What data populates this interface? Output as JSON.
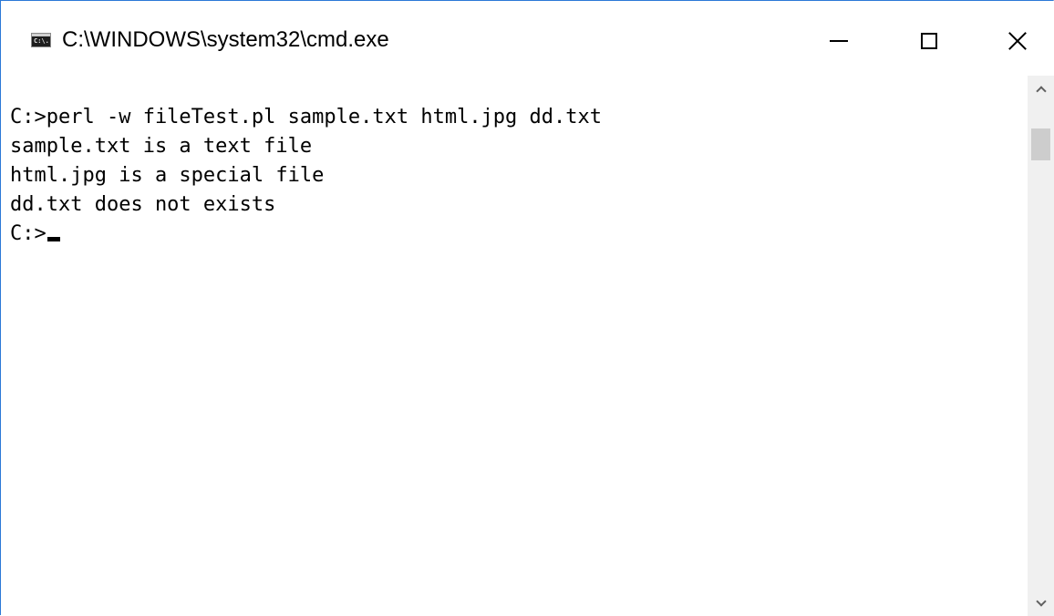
{
  "window": {
    "title": "C:\\WINDOWS\\system32\\cmd.exe",
    "icon": "console-app-icon",
    "icon_text": "C:\\."
  },
  "caption_buttons": {
    "minimize": "minimize-icon",
    "maximize": "maximize-icon",
    "close": "close-icon"
  },
  "console": {
    "lines": [
      "C:>perl -w fileTest.pl sample.txt html.jpg dd.txt",
      "sample.txt is a text file",
      "html.jpg is a special file",
      "dd.txt does not exists"
    ],
    "prompt": "C:>"
  },
  "colors": {
    "background": "#ffffff",
    "text": "#000000",
    "scrollbar_track": "#f0f0f0",
    "scrollbar_thumb": "#cdcdcd",
    "window_border": "#2b79d7"
  }
}
